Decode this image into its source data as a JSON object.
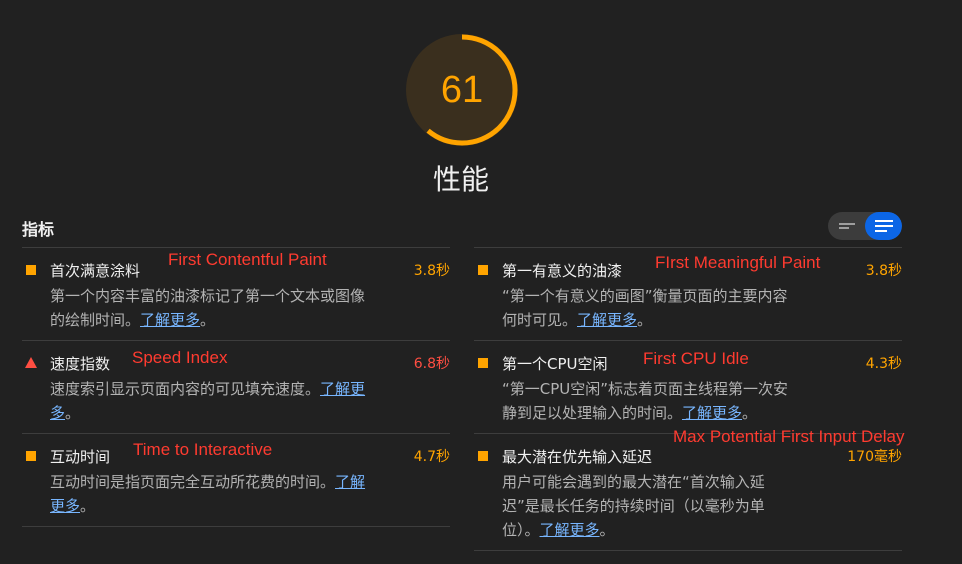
{
  "score": {
    "value": "61",
    "fraction": 0.61,
    "color": "#ffa400",
    "track_color": "#3d2e13"
  },
  "category": {
    "title": "性能"
  },
  "metrics_heading": "指标",
  "view_toggle": {
    "left_icon": "collapsed-list-icon",
    "right_icon": "expanded-list-icon",
    "active": "expanded",
    "active_color": "#0c66e6"
  },
  "metrics": {
    "fcp": {
      "title": "首次满意涂料",
      "value": "3.8秒",
      "desc": "第一个内容丰富的油漆标记了第一个文本或图像的绘制时间。",
      "link": "了解更多",
      "suffix": "。",
      "status": "average",
      "annotation": "First Contentful Paint"
    },
    "fmp": {
      "title": "第一有意义的油漆",
      "value": "3.8秒",
      "desc": "“第一个有意义的画图”衡量页面的主要内容何时可见。",
      "link": "了解更多",
      "suffix": "。",
      "status": "average",
      "annotation": "FIrst Meaningful Paint"
    },
    "si": {
      "title": "速度指数",
      "value": "6.8秒",
      "desc": "速度索引显示页面内容的可见填充速度。",
      "link": "了解更多",
      "suffix": "。",
      "status": "fail",
      "annotation": "Speed Index"
    },
    "fci": {
      "title": "第一个CPU空闲",
      "value": "4.3秒",
      "desc": "“第一CPU空闲”标志着页面主线程第一次安静到足以处理输入的时间。",
      "link": "了解更多",
      "suffix": "。",
      "status": "average",
      "annotation": "First CPU Idle"
    },
    "tti": {
      "title": "互动时间",
      "value": "4.7秒",
      "desc": "互动时间是指页面完全互动所花费的时间。",
      "link": "了解更多",
      "suffix": "。",
      "status": "average",
      "annotation": "Time to Interactive"
    },
    "mpfid": {
      "title": "最大潜在优先输入延迟",
      "value": "170毫秒",
      "desc": "用户可能会遇到的最大潜在“首次输入延迟”是最长任务的持续时间（以毫秒为单位）。",
      "link": "了解更多",
      "suffix": "。",
      "status": "average",
      "annotation": "Max Potential First Input Delay"
    }
  }
}
